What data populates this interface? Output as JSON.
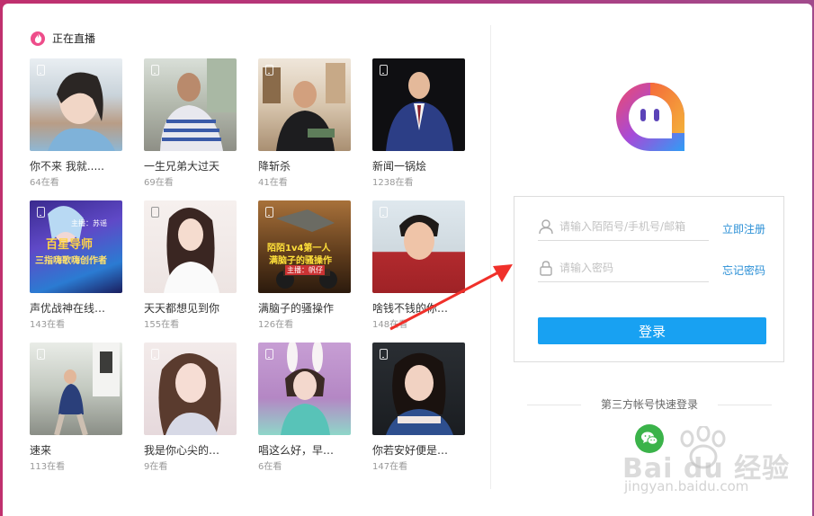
{
  "live": {
    "title": "正在直播",
    "streams": [
      {
        "name": "你不来 我就.....",
        "viewers": "64在看"
      },
      {
        "name": "一生兄弟大过天",
        "viewers": "69在看"
      },
      {
        "name": "降斩杀",
        "viewers": "41在看"
      },
      {
        "name": "新闻一锅烩",
        "viewers": "1238在看"
      },
      {
        "name": "声优战神在线…",
        "viewers": "143在看",
        "thumb_text": [
          "主播：苏谣",
          "百星导师",
          "三指嗨歌嗨创作者"
        ]
      },
      {
        "name": "天天都想见到你",
        "viewers": "155在看"
      },
      {
        "name": "满脑子的骚操作",
        "viewers": "126在看",
        "thumb_text": [
          "陌陌1v4第一人",
          "满脑子的骚操作",
          "主播：帆仔"
        ]
      },
      {
        "name": "啥钱不钱的你…",
        "viewers": "148在看"
      },
      {
        "name": "速来",
        "viewers": "113在看"
      },
      {
        "name": "我是你心尖的…",
        "viewers": "9在看"
      },
      {
        "name": "唱这么好，早…",
        "viewers": "6在看"
      },
      {
        "name": "你若安好便是…",
        "viewers": "147在看"
      }
    ]
  },
  "login": {
    "account_placeholder": "请输入陌陌号/手机号/邮箱",
    "password_placeholder": "请输入密码",
    "register_link": "立即注册",
    "forgot_link": "忘记密码",
    "login_button": "登录",
    "third_party_title": "第三方帐号快速登录",
    "third_party_icons": [
      "wechat-icon"
    ]
  },
  "overlay": {
    "arrow_color": "#f0302a",
    "watermark_brand": "Bai du 经验",
    "watermark_url": "jingyan.baidu.com"
  },
  "colors": {
    "background_gradient": [
      "#c0306e",
      "#a14a8c"
    ],
    "accent": "#18a1f2",
    "link": "#2a8fd6"
  }
}
